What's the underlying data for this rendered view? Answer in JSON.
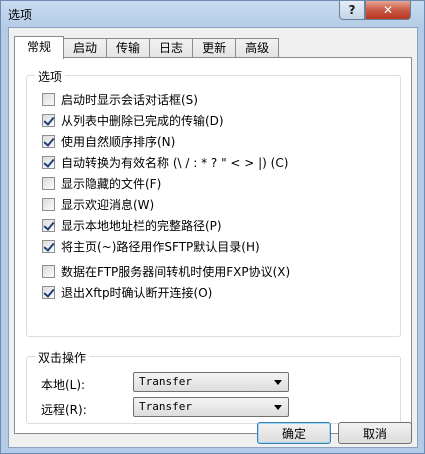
{
  "window": {
    "title": "选项",
    "help_label": "?",
    "close_label": "✕"
  },
  "tabs": [
    {
      "label": "常规"
    },
    {
      "label": "启动"
    },
    {
      "label": "传输"
    },
    {
      "label": "日志"
    },
    {
      "label": "更新"
    },
    {
      "label": "高级"
    }
  ],
  "active_tab": "常规",
  "options_group": {
    "title": "选项",
    "items": [
      {
        "label": "启动时显示会话对话框(S)",
        "checked": false
      },
      {
        "label": "从列表中删除已完成的传输(D)",
        "checked": true
      },
      {
        "label": "使用自然顺序排序(N)",
        "checked": true
      },
      {
        "label": "自动转换为有效名称 (\\ / : * ? \" < > |) (C)",
        "checked": true
      },
      {
        "label": "显示隐藏的文件(F)",
        "checked": false
      },
      {
        "label": "显示欢迎消息(W)",
        "checked": false
      },
      {
        "label": "显示本地地址栏的完整路径(P)",
        "checked": true
      },
      {
        "label": "将主页(~)路径用作SFTP默认目录(H)",
        "checked": true
      },
      {
        "label": "数据在FTP服务器间转机时使用FXP协议(X)",
        "checked": false
      },
      {
        "label": "退出Xftp时确认断开连接(O)",
        "checked": true
      }
    ]
  },
  "dblclick_group": {
    "title": "双击操作",
    "local_label": "本地(L):",
    "local_value": "Transfer",
    "remote_label": "远程(R):",
    "remote_value": "Transfer"
  },
  "buttons": {
    "ok": "确定",
    "cancel": "取消"
  }
}
